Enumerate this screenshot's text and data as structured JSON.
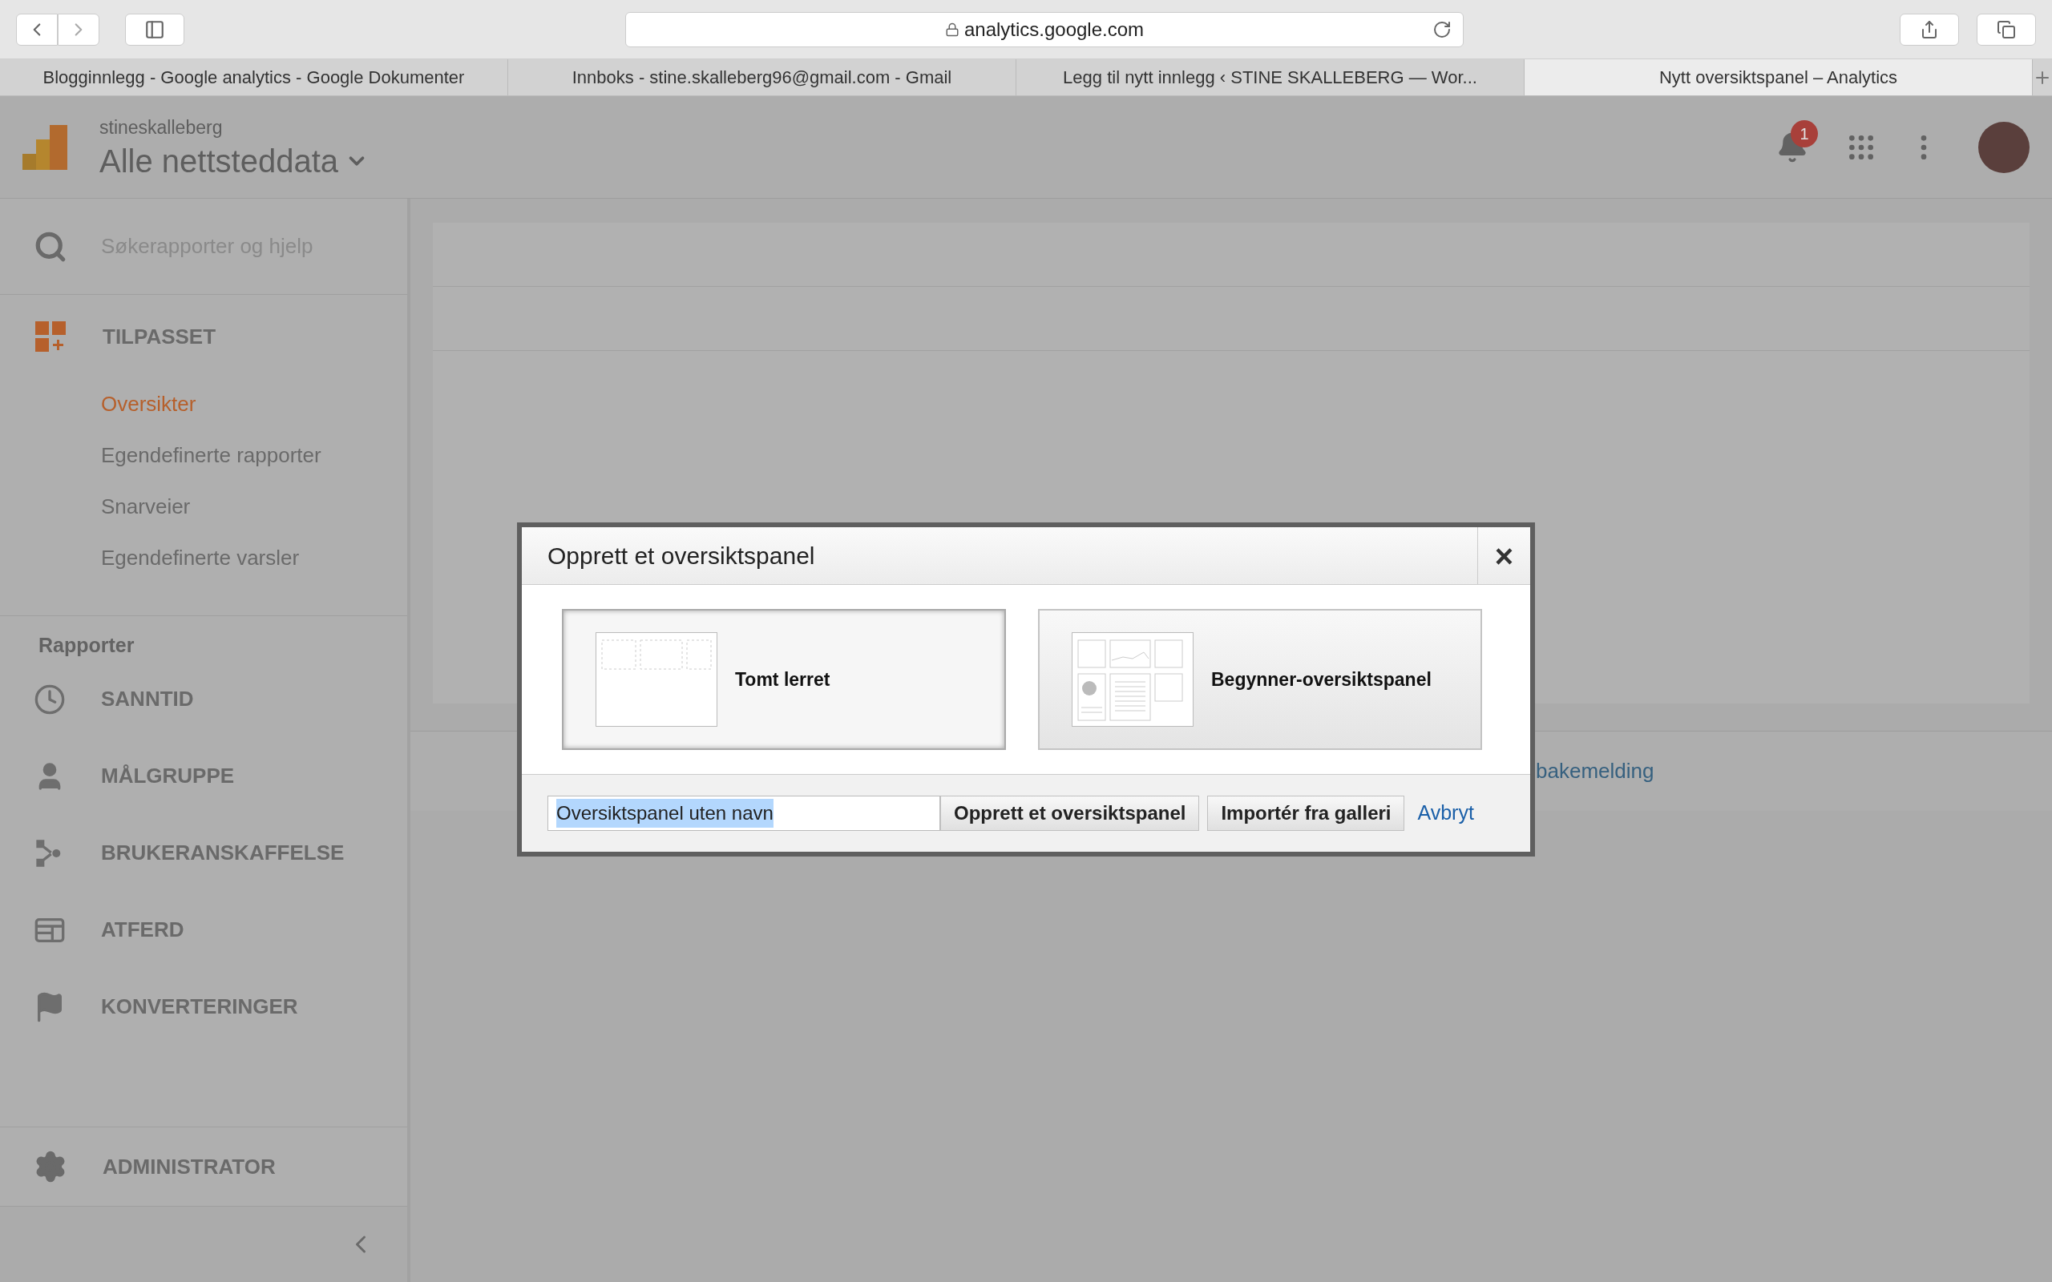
{
  "browser": {
    "address": "analytics.google.com",
    "tabs": [
      {
        "label": "Blogginnlegg - Google analytics - Google Dokumenter",
        "selected": false
      },
      {
        "label": "Innboks - stine.skalleberg96@gmail.com - Gmail",
        "selected": false
      },
      {
        "label": "Legg til nytt innlegg ‹ STINE SKALLEBERG — Wor...",
        "selected": false
      },
      {
        "label": "Nytt oversiktspanel – Analytics",
        "selected": true
      }
    ]
  },
  "header": {
    "account": "stineskalleberg",
    "property": "Alle nettsteddata",
    "notifications": "1"
  },
  "sidebar": {
    "search_placeholder": "Søkerapporter og hjelp",
    "custom": {
      "title": "TILPASSET",
      "items": [
        {
          "label": "Oversikter",
          "selected": true
        },
        {
          "label": "Egendefinerte rapporter",
          "selected": false
        },
        {
          "label": "Snarveier",
          "selected": false
        },
        {
          "label": "Egendefinerte varsler",
          "selected": false
        }
      ]
    },
    "reports": {
      "heading": "Rapporter",
      "items": [
        "SANNTID",
        "MÅLGRUPPE",
        "BRUKERANSKAFFELSE",
        "ATFERD",
        "KONVERTERINGER"
      ]
    },
    "admin": "ADMINISTRATOR"
  },
  "footer_link": "bakemelding",
  "dialog": {
    "title": "Opprett et oversiktspanel",
    "close": "×",
    "options": [
      {
        "kind": "blank",
        "label": "Tomt lerret",
        "selected": true
      },
      {
        "kind": "starter",
        "label": "Begynner-oversiktspanel",
        "selected": false
      }
    ],
    "name_field": {
      "value": "Oversiktspanel uten navn"
    },
    "buttons": [
      "Opprett et oversiktspanel",
      "Importér fra galleri"
    ],
    "cancel": "Avbryt"
  }
}
